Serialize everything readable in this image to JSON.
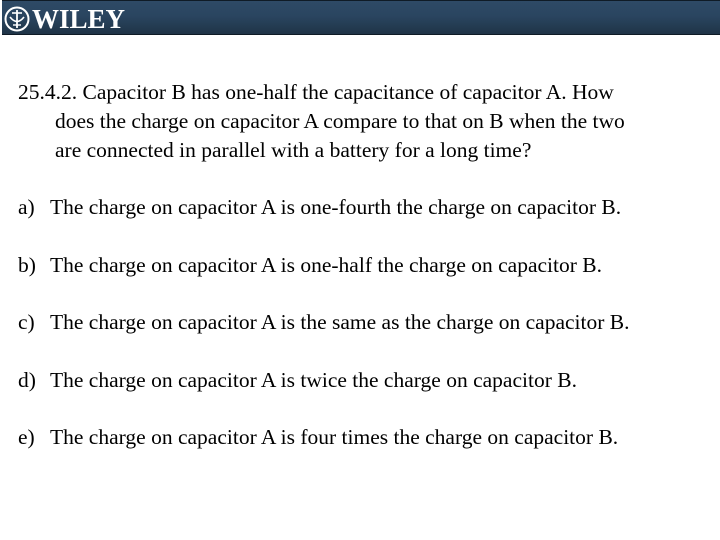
{
  "header": {
    "logo_icon": "wiley-seal-icon",
    "logo_text": "WILEY",
    "background_color": "#2a4560"
  },
  "question": {
    "number": "25.4.2.",
    "lines": [
      "25.4.2. Capacitor B has one-half the capacitance of capacitor A.  How",
      "does the charge on capacitor A compare to that on B when the two",
      "are connected in parallel with a battery for a long time?"
    ]
  },
  "options": [
    {
      "letter": "a)",
      "text": "The charge on capacitor A is one-fourth the charge on capacitor B."
    },
    {
      "letter": "b)",
      "text": "The charge on capacitor A is one-half the charge on capacitor B."
    },
    {
      "letter": "c)",
      "text": "The charge on capacitor A is the same as the charge on capacitor B."
    },
    {
      "letter": "d)",
      "text": "The charge on capacitor A is twice the charge on capacitor B."
    },
    {
      "letter": "e)",
      "text": "The charge on capacitor A is four times the charge on capacitor B."
    }
  ]
}
